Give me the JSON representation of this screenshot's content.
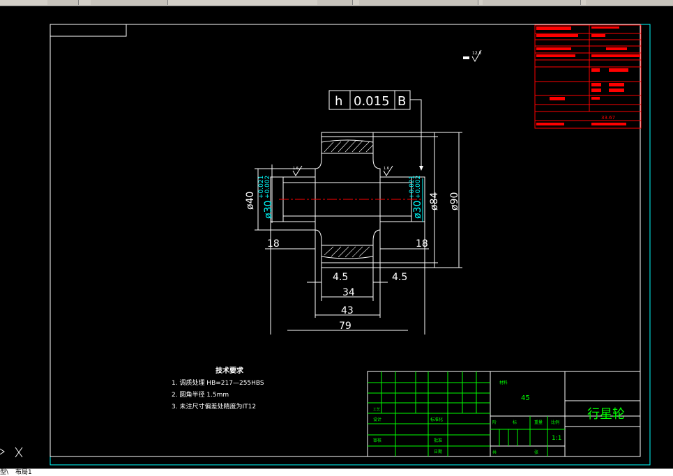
{
  "tabs": {
    "model": "型\\",
    "layout": "布局1"
  },
  "drawing": {
    "tolerance_symbol": "h",
    "tolerance_value": "0.015",
    "datum": "B",
    "roughness_top": "12.5",
    "roughness_left": "1.6",
    "roughness_right": "1.6",
    "dim_d40": "ø40",
    "dim_d30_left": "ø30",
    "dim_d30_right": "ø30",
    "dim_d84": "ø84",
    "dim_d90": "ø90",
    "tol_upper": "+0.021",
    "tol_lower": "+0.002",
    "dim_18_left": "18",
    "dim_18_right": "18",
    "dim_45_left": "4.5",
    "dim_45_right": "4.5",
    "dim_34": "34",
    "dim_43": "43",
    "dim_79": "79"
  },
  "notes": {
    "title": "技术要求",
    "items": [
      "1. 调质处理 HB=217—255HBS",
      "2. 圆角半径  1.5mm",
      "3. 未注尺寸偏差处精度为IT12"
    ]
  },
  "title_block": {
    "part_name": "行星轮",
    "material": "45",
    "scale": "1:1",
    "labels": {
      "mat_hdr": "材料",
      "stage": "阶",
      "mark": "标",
      "weight": "重量",
      "scale_hdr": "比例",
      "sheet": "共",
      "sheet2": "张",
      "design": "设计",
      "check": "审核",
      "process": "工艺",
      "std": "标准化",
      "approve": "批准",
      "date": "日期"
    }
  },
  "params": {
    "mass": "33.67"
  },
  "colors": {
    "border": "#00ffff",
    "frame": "#ffffff",
    "grid": "#00ff00",
    "accent": "#ff0000",
    "part": "#ffffff",
    "dim_cyan": "#00ffff"
  }
}
